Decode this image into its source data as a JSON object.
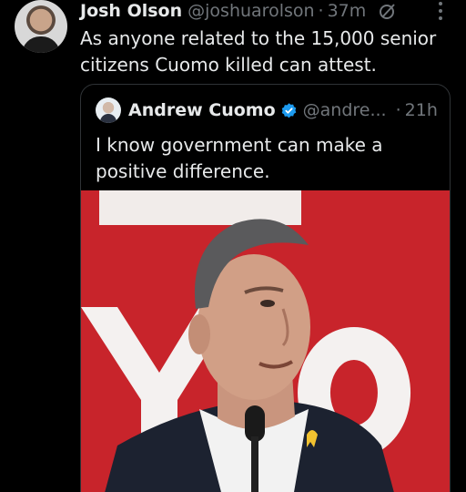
{
  "tweet": {
    "author_name": "Josh Olson",
    "author_handle": "@joshuarolson",
    "separator": "·",
    "time": "37m",
    "text": "As anyone related to the 15,000 senior citizens Cuomo killed can attest."
  },
  "quoted_tweet": {
    "author_name": "Andrew Cuomo",
    "author_handle": "@andre...",
    "separator": "·",
    "time": "21h",
    "text": "I know government can make a positive difference.",
    "photo_background_text": "YO"
  },
  "icons": {
    "grok": "grok-icon",
    "more": "more-icon",
    "verified": "verified-icon"
  },
  "colors": {
    "background": "#000000",
    "text_primary": "#e7e9ea",
    "text_secondary": "#71767b",
    "verified_blue": "#1d9bf0",
    "banner_red": "#c8242b"
  }
}
